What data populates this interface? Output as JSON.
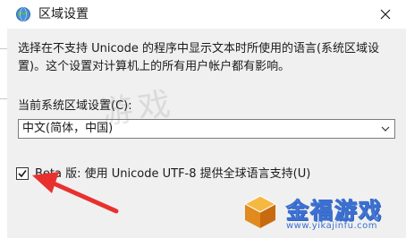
{
  "dialog": {
    "title": "区域设置",
    "description": "选择在不支持 Unicode 的程序中显示文本时所使用的语言(系统区域设置)。这个设置对计算机上的所有用户帐户都有影响。",
    "current_locale_label": "当前系统区域设置(C):",
    "current_locale_value": "中文(简体，中国)",
    "beta_checkbox_label": "Beta 版: 使用 Unicode UTF-8 提供全球语言支持(U)",
    "beta_checked": true
  },
  "overlay": {
    "watermark_text": "游戏",
    "logo_text": "金福游戏",
    "logo_url": "www.yikajinfu.com",
    "arrow_color": "#e8312f",
    "logo_color": "#3b6fd0"
  }
}
